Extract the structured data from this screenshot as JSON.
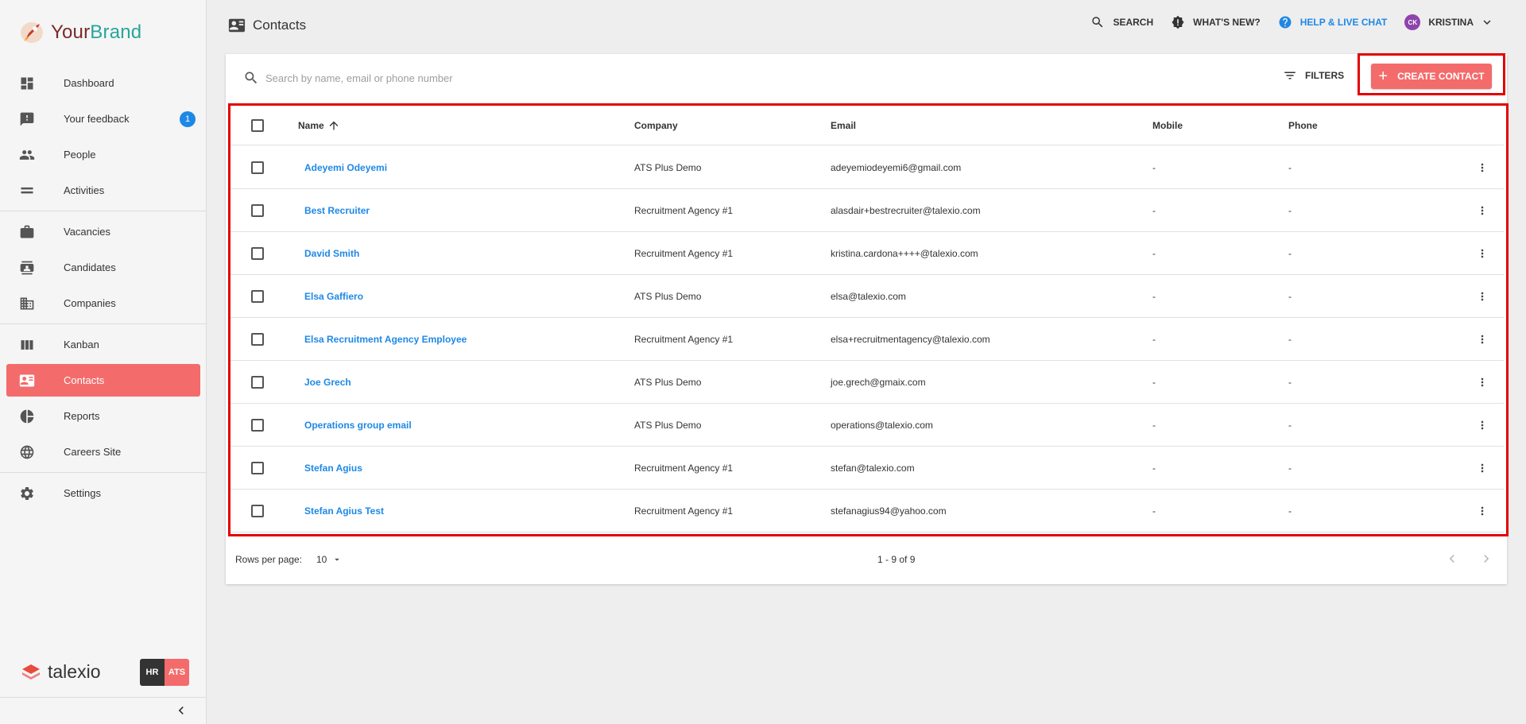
{
  "brand": {
    "your": "Your",
    "name": "Brand"
  },
  "sidebar": {
    "items": [
      {
        "label": "Dashboard",
        "icon": "dashboard-icon"
      },
      {
        "label": "Your feedback",
        "icon": "feedback-icon",
        "badge": "1"
      },
      {
        "label": "People",
        "icon": "people-icon"
      },
      {
        "label": "Activities",
        "icon": "activities-icon"
      },
      {
        "label": "Vacancies",
        "icon": "briefcase-icon"
      },
      {
        "label": "Candidates",
        "icon": "candidates-icon"
      },
      {
        "label": "Companies",
        "icon": "building-icon"
      },
      {
        "label": "Kanban",
        "icon": "kanban-icon"
      },
      {
        "label": "Contacts",
        "icon": "contact-card-icon",
        "active": true
      },
      {
        "label": "Reports",
        "icon": "pie-chart-icon"
      },
      {
        "label": "Careers Site",
        "icon": "globe-icon"
      },
      {
        "label": "Settings",
        "icon": "gear-icon"
      }
    ],
    "footer_logo": "talexio",
    "switch_hr": "HR",
    "switch_ats": "ATS"
  },
  "header": {
    "title": "Contacts",
    "search_label": "SEARCH",
    "whats_new_label": "WHAT'S NEW?",
    "help_label": "HELP & LIVE CHAT",
    "user_initials": "CK",
    "user_name": "KRISTINA"
  },
  "toolbar": {
    "search_placeholder": "Search by name, email or phone number",
    "filters_label": "FILTERS",
    "create_label": "CREATE CONTACT"
  },
  "table": {
    "columns": {
      "name": "Name",
      "company": "Company",
      "email": "Email",
      "mobile": "Mobile",
      "phone": "Phone"
    },
    "rows": [
      {
        "name": "Adeyemi Odeyemi",
        "company": "ATS Plus Demo",
        "email": "adeyemiodeyemi6@gmail.com",
        "mobile": "-",
        "phone": "-"
      },
      {
        "name": "Best Recruiter",
        "company": "Recruitment Agency #1",
        "email": "alasdair+bestrecruiter@talexio.com",
        "mobile": "-",
        "phone": "-"
      },
      {
        "name": "David Smith",
        "company": "Recruitment Agency #1",
        "email": "kristina.cardona++++@talexio.com",
        "mobile": "-",
        "phone": "-"
      },
      {
        "name": "Elsa Gaffiero",
        "company": "ATS Plus Demo",
        "email": "elsa@talexio.com",
        "mobile": "-",
        "phone": "-"
      },
      {
        "name": "Elsa Recruitment Agency Employee",
        "company": "Recruitment Agency #1",
        "email": "elsa+recruitmentagency@talexio.com",
        "mobile": "-",
        "phone": "-"
      },
      {
        "name": "Joe Grech",
        "company": "ATS Plus Demo",
        "email": "joe.grech@gmaix.com",
        "mobile": "-",
        "phone": "-"
      },
      {
        "name": "Operations group email",
        "company": "ATS Plus Demo",
        "email": "operations@talexio.com",
        "mobile": "-",
        "phone": "-"
      },
      {
        "name": "Stefan Agius",
        "company": "Recruitment Agency #1",
        "email": "stefan@talexio.com",
        "mobile": "-",
        "phone": "-"
      },
      {
        "name": "Stefan Agius Test",
        "company": "Recruitment Agency #1",
        "email": "stefanagius94@yahoo.com",
        "mobile": "-",
        "phone": "-"
      }
    ]
  },
  "pagination": {
    "rows_per_page_label": "Rows per page:",
    "rows_per_page_value": "10",
    "range": "1 - 9 of 9"
  },
  "colors": {
    "accent": "#f46b6b",
    "link": "#1e88e5",
    "highlight": "#e30000"
  }
}
